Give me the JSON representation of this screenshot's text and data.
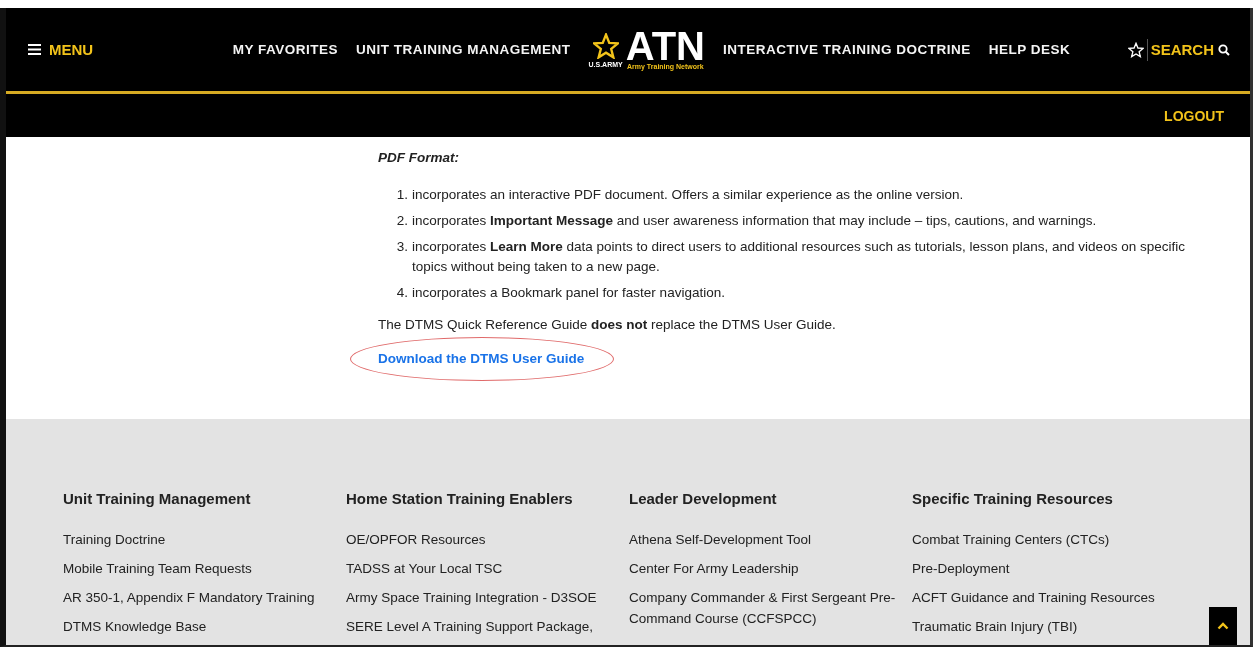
{
  "header": {
    "menu_label": "MENU",
    "nav_left": [
      "MY FAVORITES",
      "UNIT TRAINING MANAGEMENT"
    ],
    "logo": {
      "title": "ATN",
      "army": "U.S.ARMY",
      "subtitle": "Army Training Network"
    },
    "nav_right": [
      "INTERACTIVE TRAINING DOCTRINE",
      "HELP DESK"
    ],
    "search_label": "SEARCH",
    "logout_label": "LOGOUT"
  },
  "content": {
    "heading": "PDF Format:",
    "list": [
      {
        "number": "1.",
        "text": "incorporates an interactive PDF document. Offers a similar experience as the online version."
      },
      {
        "number": "2.",
        "text": "incorporates **Important Message** and user awareness information that may include – tips, cautions, and warnings."
      },
      {
        "number": "3.",
        "text": "incorporates **Learn More** data points to direct users to additional resources such as tutorials, lesson plans, and videos on specific topics without being taken to a new page."
      },
      {
        "number": "4.",
        "text": "incorporates a Bookmark panel for faster navigation."
      }
    ],
    "note": "The DTMS Quick Reference Guide **does not** replace the DTMS User Guide.",
    "download_link": {
      "label": "Download the DTMS User Guide",
      "circled": true
    }
  },
  "footer": {
    "columns": [
      {
        "heading": "Unit Training Management",
        "links": [
          "Training Doctrine",
          "Mobile Training Team Requests",
          "AR 350-1, Appendix F Mandatory Training",
          "DTMS Knowledge Base"
        ]
      },
      {
        "heading": "Home Station Training Enablers",
        "links": [
          "OE/OPFOR Resources",
          "TADSS at Your Local TSC",
          "Army Space Training Integration - D3SOE",
          "SERE Level A Training Support Package,"
        ]
      },
      {
        "heading": "Leader Development",
        "links": [
          "Athena Self-Development Tool",
          "Center For Army Leadership",
          "Company Commander & First Sergeant Pre-Command Course (CCFSPCC)"
        ]
      },
      {
        "heading": "Specific Training Resources",
        "links": [
          "Combat Training Centers (CTCs)",
          "Pre-Deployment",
          "ACFT Guidance and Training Resources",
          "Traumatic Brain Injury (TBI)"
        ]
      }
    ]
  }
}
